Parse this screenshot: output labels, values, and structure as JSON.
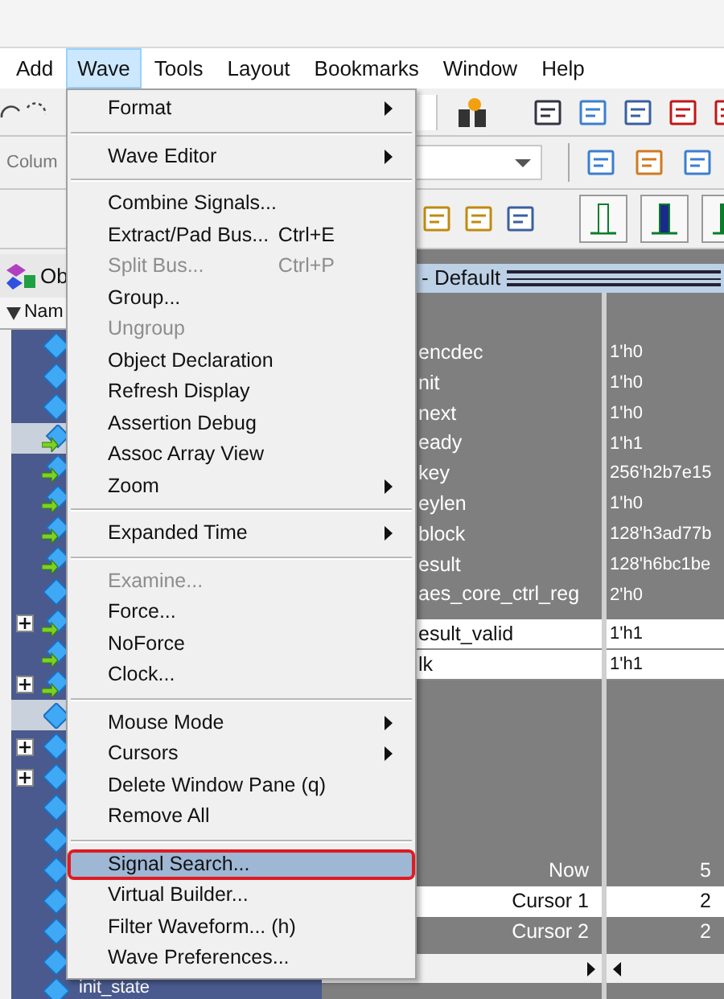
{
  "menu_bar": [
    {
      "label": "Add",
      "selected": false
    },
    {
      "label": "Wave",
      "selected": true
    },
    {
      "label": "Tools",
      "selected": false
    },
    {
      "label": "Layout",
      "selected": false
    },
    {
      "label": "Bookmarks",
      "selected": false
    },
    {
      "label": "Window",
      "selected": false
    },
    {
      "label": "Help",
      "selected": false
    }
  ],
  "toolbar": {
    "column_label": "Colum"
  },
  "objects_panel": {
    "title": "Ob",
    "column_header": "Nam",
    "rows": [
      {
        "kind": "plain",
        "expandable": false,
        "selected": false
      },
      {
        "kind": "plain",
        "expandable": false,
        "selected": false
      },
      {
        "kind": "plain",
        "expandable": false,
        "selected": false
      },
      {
        "kind": "port",
        "expandable": false,
        "selected": true
      },
      {
        "kind": "port",
        "expandable": false,
        "selected": false
      },
      {
        "kind": "port",
        "expandable": false,
        "selected": false
      },
      {
        "kind": "port",
        "expandable": false,
        "selected": false
      },
      {
        "kind": "port",
        "expandable": false,
        "selected": false
      },
      {
        "kind": "plain",
        "expandable": false,
        "selected": false
      },
      {
        "kind": "port",
        "expandable": true,
        "selected": false
      },
      {
        "kind": "port",
        "expandable": false,
        "selected": false
      },
      {
        "kind": "port",
        "expandable": true,
        "selected": false
      },
      {
        "kind": "plain",
        "expandable": false,
        "selected": true
      },
      {
        "kind": "plain",
        "expandable": true,
        "selected": false
      },
      {
        "kind": "plain",
        "expandable": true,
        "selected": false
      },
      {
        "kind": "plain",
        "expandable": false,
        "selected": false
      },
      {
        "kind": "plain",
        "expandable": false,
        "selected": false
      },
      {
        "kind": "plain",
        "expandable": false,
        "selected": false
      },
      {
        "kind": "plain",
        "expandable": false,
        "selected": false
      },
      {
        "kind": "plain",
        "expandable": false,
        "selected": false
      },
      {
        "kind": "plain",
        "expandable": false,
        "selected": false
      },
      {
        "kind": "plain",
        "expandable": false,
        "selected": false,
        "label": "init_state"
      }
    ]
  },
  "wave_panel": {
    "title": "- Default",
    "signals": [
      {
        "name": "encdec",
        "value": "1'h0",
        "highlighted": false
      },
      {
        "name": "nit",
        "value": "1'h0",
        "highlighted": false
      },
      {
        "name": "next",
        "value": "1'h0",
        "highlighted": false
      },
      {
        "name": "eady",
        "value": "1'h1",
        "highlighted": false
      },
      {
        "name": "key",
        "value": "256'h2b7e15",
        "highlighted": false
      },
      {
        "name": "eylen",
        "value": "1'h0",
        "highlighted": false
      },
      {
        "name": "block",
        "value": "128'h3ad77b",
        "highlighted": false
      },
      {
        "name": "esult",
        "value": "128'h6bc1be",
        "highlighted": false
      },
      {
        "name": "aes_core_ctrl_reg",
        "value": "2'h0",
        "highlighted": false
      },
      {
        "name": "esult_valid",
        "value": "1'h1",
        "highlighted": true
      },
      {
        "name": "lk",
        "value": "1'h1",
        "highlighted": true
      }
    ],
    "cursors": [
      {
        "label": "Now",
        "time": "5",
        "highlighted": false
      },
      {
        "label": "Cursor 1",
        "time": "2",
        "highlighted": true
      },
      {
        "label": "Cursor 2",
        "time": "2",
        "highlighted": false
      }
    ]
  },
  "wave_menu": [
    {
      "kind": "item",
      "label": "Format",
      "submenu": true,
      "disabled": false,
      "selected": false
    },
    {
      "kind": "separator"
    },
    {
      "kind": "item",
      "label": "Wave Editor",
      "submenu": true,
      "disabled": false,
      "selected": false
    },
    {
      "kind": "separator"
    },
    {
      "kind": "item",
      "label": "Combine Signals...",
      "submenu": false,
      "disabled": false,
      "selected": false
    },
    {
      "kind": "item",
      "label": "Extract/Pad Bus...",
      "shortcut": "Ctrl+E",
      "submenu": false,
      "disabled": false,
      "selected": false
    },
    {
      "kind": "item",
      "label": "Split Bus...",
      "shortcut": "Ctrl+P",
      "submenu": false,
      "disabled": true,
      "selected": false
    },
    {
      "kind": "item",
      "label": "Group...",
      "submenu": false,
      "disabled": false,
      "selected": false
    },
    {
      "kind": "item",
      "label": "Ungroup",
      "submenu": false,
      "disabled": true,
      "selected": false
    },
    {
      "kind": "item",
      "label": "Object Declaration",
      "submenu": false,
      "disabled": false,
      "selected": false
    },
    {
      "kind": "item",
      "label": "Refresh Display",
      "submenu": false,
      "disabled": false,
      "selected": false
    },
    {
      "kind": "item",
      "label": "Assertion Debug",
      "submenu": false,
      "disabled": false,
      "selected": false
    },
    {
      "kind": "item",
      "label": "Assoc Array View",
      "submenu": false,
      "disabled": false,
      "selected": false
    },
    {
      "kind": "item",
      "label": "Zoom",
      "submenu": true,
      "disabled": false,
      "selected": false
    },
    {
      "kind": "separator"
    },
    {
      "kind": "item",
      "label": "Expanded Time",
      "submenu": true,
      "disabled": false,
      "selected": false
    },
    {
      "kind": "separator"
    },
    {
      "kind": "item",
      "label": "Examine...",
      "submenu": false,
      "disabled": true,
      "selected": false
    },
    {
      "kind": "item",
      "label": "Force...",
      "submenu": false,
      "disabled": false,
      "selected": false
    },
    {
      "kind": "item",
      "label": "NoForce",
      "submenu": false,
      "disabled": false,
      "selected": false
    },
    {
      "kind": "item",
      "label": "Clock...",
      "submenu": false,
      "disabled": false,
      "selected": false
    },
    {
      "kind": "separator"
    },
    {
      "kind": "item",
      "label": "Mouse Mode",
      "submenu": true,
      "disabled": false,
      "selected": false
    },
    {
      "kind": "item",
      "label": "Cursors",
      "submenu": true,
      "disabled": false,
      "selected": false
    },
    {
      "kind": "item",
      "label": "Delete Window Pane (q)",
      "submenu": false,
      "disabled": false,
      "selected": false
    },
    {
      "kind": "item",
      "label": "Remove All",
      "submenu": false,
      "disabled": false,
      "selected": false
    },
    {
      "kind": "separator"
    },
    {
      "kind": "item",
      "label": "Signal Search...",
      "submenu": false,
      "disabled": false,
      "selected": true
    },
    {
      "kind": "item",
      "label": "Virtual Builder...",
      "submenu": false,
      "disabled": false,
      "selected": false
    },
    {
      "kind": "item",
      "label": "Filter Waveform... (h)",
      "submenu": false,
      "disabled": false,
      "selected": false
    },
    {
      "kind": "item",
      "label": "Wave Preferences...",
      "submenu": false,
      "disabled": false,
      "selected": false
    }
  ]
}
